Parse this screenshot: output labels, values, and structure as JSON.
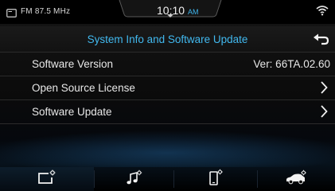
{
  "status_bar": {
    "radio": "FM 87.5 MHz",
    "time": "10:10",
    "ampm": "AM",
    "wifi_icon": "wifi-icon",
    "radio_icon": "radio-icon"
  },
  "header": {
    "title": "System Info and Software Update",
    "back_icon": "back-arrow-icon"
  },
  "list": {
    "items": [
      {
        "label": "Software Version",
        "value": "Ver: 66TA.02.60"
      },
      {
        "label": "Open Source License",
        "icon": "chevron-right-icon"
      },
      {
        "label": "Software Update",
        "icon": "chevron-right-icon"
      }
    ]
  },
  "bottom_nav": {
    "tabs": [
      {
        "icon": "display-settings-icon",
        "selected": true
      },
      {
        "icon": "sound-settings-icon",
        "selected": false
      },
      {
        "icon": "phone-settings-icon",
        "selected": false
      },
      {
        "icon": "vehicle-settings-icon",
        "selected": false
      }
    ]
  },
  "colors": {
    "accent": "#41b8ee",
    "text": "#e8e8e8",
    "background": "#101010"
  }
}
